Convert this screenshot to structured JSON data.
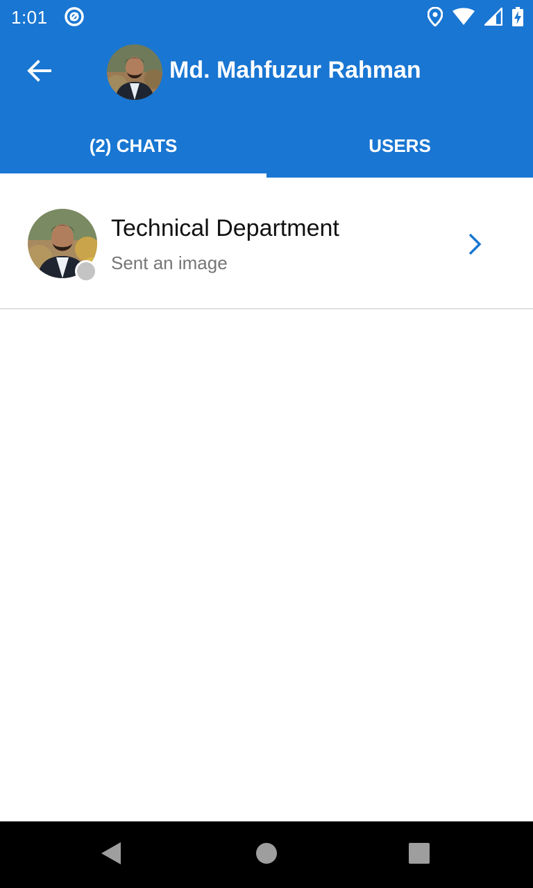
{
  "status_bar": {
    "time": "1:01",
    "app_icon": "at-sign-icon",
    "icons": [
      "location-icon",
      "wifi-icon",
      "signal-icon",
      "battery-charging-icon"
    ]
  },
  "header": {
    "back_icon": "arrow-left-icon",
    "user_name": "Md. Mahfuzur Rahman"
  },
  "tabs": [
    {
      "label": "(2) CHATS",
      "selected": true
    },
    {
      "label": "USERS",
      "selected": false
    }
  ],
  "chats": [
    {
      "title": "Technical Department",
      "subtitle": "Sent an image",
      "presence": "offline",
      "chevron_icon": "chevron-right-icon"
    }
  ],
  "nav": {
    "icons": [
      "nav-back-icon",
      "nav-home-icon",
      "nav-recents-icon"
    ]
  },
  "colors": {
    "primary": "#1976d2",
    "presence_offline": "#c4c4c4",
    "text_primary": "#111111",
    "text_secondary": "#757575"
  }
}
